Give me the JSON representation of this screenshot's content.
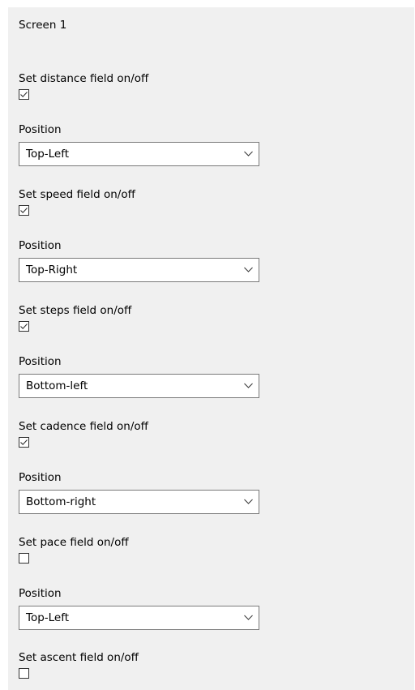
{
  "screen": {
    "title": "Screen 1"
  },
  "fields": [
    {
      "toggle_label": "Set distance field on/off",
      "checked": true,
      "position_label": "Position",
      "position_value": "Top-Left"
    },
    {
      "toggle_label": "Set speed field on/off",
      "checked": true,
      "position_label": "Position",
      "position_value": "Top-Right"
    },
    {
      "toggle_label": "Set steps field on/off",
      "checked": true,
      "position_label": "Position",
      "position_value": "Bottom-left"
    },
    {
      "toggle_label": "Set cadence field on/off",
      "checked": true,
      "position_label": "Position",
      "position_value": "Bottom-right"
    },
    {
      "toggle_label": "Set pace field on/off",
      "checked": false,
      "position_label": "Position",
      "position_value": "Top-Left"
    },
    {
      "toggle_label": "Set ascent field on/off",
      "checked": false
    }
  ],
  "icons": {
    "checkbox_check": "checkmark-icon",
    "dropdown": "chevron-down-icon"
  },
  "colors": {
    "panel_bg": "#f0f0f0",
    "select_border": "#7a7a7a",
    "checkbox_border": "#333333"
  }
}
